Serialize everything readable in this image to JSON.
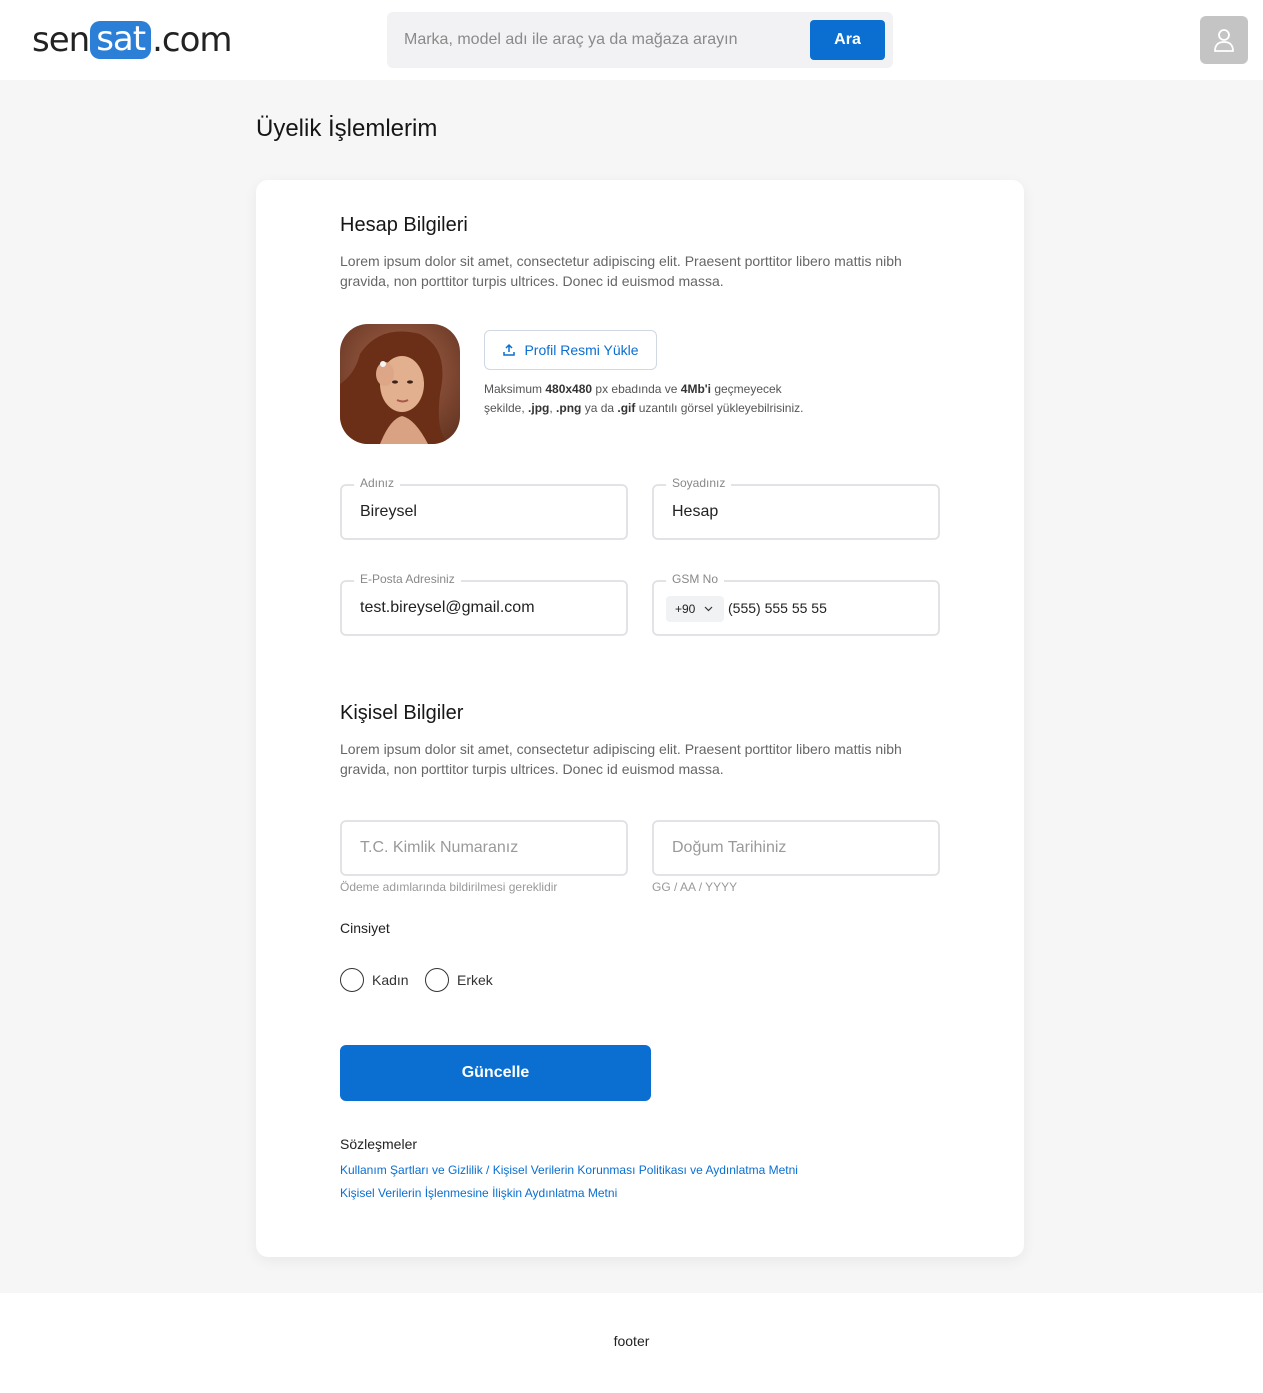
{
  "header": {
    "logo": {
      "part1": "sen",
      "part2": "sat",
      "part3": ".com"
    },
    "search": {
      "placeholder": "Marka, model adı ile araç ya da mağaza arayın",
      "button_label": "Ara"
    },
    "user_icon": "user-icon"
  },
  "page": {
    "title": "Üyelik İşlemlerim"
  },
  "account": {
    "title": "Hesap Bilgileri",
    "description": "Lorem ipsum dolor sit amet, consectetur adipiscing elit. Praesent porttitor libero mattis nibh gravida, non porttitor turpis ultrices. Donec id euismod massa.",
    "upload_button": "Profil Resmi Yükle",
    "upload_note": {
      "t1": "Maksimum ",
      "b1": "480x480",
      "t2": " px ebadında ve ",
      "b2": "4Mb'i",
      "t3": " geçmeyecek şekilde, ",
      "b3": ".jpg",
      "t4": ", ",
      "b4": ".png",
      "t5": " ya da ",
      "b5": ".gif",
      "t6": " uzantılı görsel yükleyebilrisiniz."
    },
    "first_name": {
      "label": "Adınız",
      "value": "Bireysel"
    },
    "last_name": {
      "label": "Soyadınız",
      "value": "Hesap"
    },
    "email": {
      "label": "E-Posta Adresiniz",
      "value": "test.bireysel@gmail.com"
    },
    "phone": {
      "label": "GSM No",
      "code": "+90",
      "number": "(555) 555 55 55"
    }
  },
  "personal": {
    "title": "Kişisel Bilgiler",
    "description": "Lorem ipsum dolor sit amet, consectetur adipiscing elit. Praesent porttitor libero mattis nibh gravida, non porttitor turpis ultrices. Donec id euismod massa.",
    "tc": {
      "placeholder": "T.C. Kimlik Numaranız",
      "hint": "Ödeme adımlarında bildirilmesi gereklidir"
    },
    "birth": {
      "placeholder": "Doğum Tarihiniz",
      "hint": "GG / AA / YYYY"
    },
    "gender_label": "Cinsiyet",
    "gender_options": [
      "Kadın",
      "Erkek"
    ],
    "submit": "Güncelle"
  },
  "contracts": {
    "title": "Sözleşmeler",
    "links": [
      "Kullanım Şartları ve Gizlilik / Kişisel Verilerin Korunması Politikası ve Aydınlatma Metni",
      "Kişisel Verilerin İşlenmesine İlişkin Aydınlatma Metni"
    ]
  },
  "footer": {
    "text": "footer"
  },
  "colors": {
    "accent": "#0a6fd1",
    "logo_blue": "#2b7fd6",
    "page_bg": "#f6f6f7"
  }
}
